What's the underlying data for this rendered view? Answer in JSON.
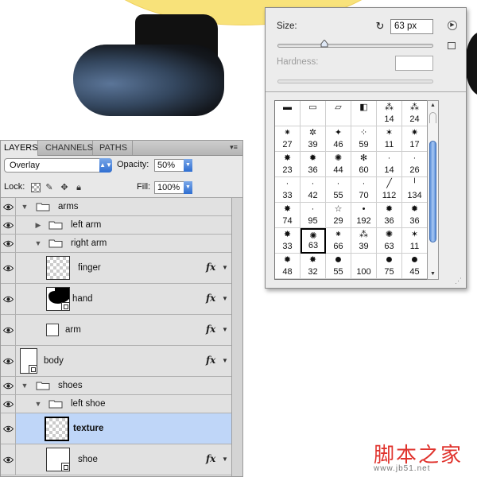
{
  "layers_panel": {
    "tabs": [
      "LAYERS",
      "CHANNELS",
      "PATHS"
    ],
    "blend_mode": "Overlay",
    "opacity_label": "Opacity:",
    "opacity_value": "50%",
    "lock_label": "Lock:",
    "fill_label": "Fill:",
    "fill_value": "100%",
    "layers": [
      {
        "name": "arms",
        "kind": "group",
        "expanded": true,
        "depth": 0
      },
      {
        "name": "left arm",
        "kind": "group",
        "expanded": false,
        "depth": 1
      },
      {
        "name": "right arm",
        "kind": "group",
        "expanded": true,
        "depth": 1
      },
      {
        "name": "finger",
        "kind": "layer",
        "depth": 2,
        "fx": "fx"
      },
      {
        "name": "hand",
        "kind": "layer",
        "depth": 2,
        "fx": "fx"
      },
      {
        "name": "arm",
        "kind": "layer",
        "depth": 1,
        "fx": "fx"
      },
      {
        "name": "body",
        "kind": "layer",
        "depth": 0,
        "fx": "fx"
      },
      {
        "name": "shoes",
        "kind": "group",
        "expanded": true,
        "depth": 0
      },
      {
        "name": "left shoe",
        "kind": "group",
        "expanded": true,
        "depth": 1
      },
      {
        "name": "texture",
        "kind": "layer",
        "depth": 2,
        "selected": true
      },
      {
        "name": "shoe",
        "kind": "layer",
        "depth": 2,
        "fx": "fx"
      }
    ]
  },
  "brush_panel": {
    "size_label": "Size:",
    "size_value": "63 px",
    "size_slider": 0.3,
    "hardness_label": "Hardness:",
    "presets": [
      {
        "label": "",
        "glyph": "▬"
      },
      {
        "label": "",
        "glyph": "▭"
      },
      {
        "label": "",
        "glyph": "▱"
      },
      {
        "label": "",
        "glyph": "◧"
      },
      {
        "label": "14",
        "glyph": "⁂"
      },
      {
        "label": "24",
        "glyph": "⁂"
      },
      {
        "label": "27",
        "glyph": "⁕"
      },
      {
        "label": "39",
        "glyph": "✲"
      },
      {
        "label": "46",
        "glyph": "✦"
      },
      {
        "label": "59",
        "glyph": "⁘"
      },
      {
        "label": "11",
        "glyph": "✶"
      },
      {
        "label": "17",
        "glyph": "✷"
      },
      {
        "label": "23",
        "glyph": "✸"
      },
      {
        "label": "36",
        "glyph": "✹"
      },
      {
        "label": "44",
        "glyph": "✺"
      },
      {
        "label": "60",
        "glyph": "✻"
      },
      {
        "label": "14",
        "glyph": "·"
      },
      {
        "label": "26",
        "glyph": "·"
      },
      {
        "label": "33",
        "glyph": "·"
      },
      {
        "label": "42",
        "glyph": "·"
      },
      {
        "label": "55",
        "glyph": "·"
      },
      {
        "label": "70",
        "glyph": "·"
      },
      {
        "label": "112",
        "glyph": "╱"
      },
      {
        "label": "134",
        "glyph": "╵"
      },
      {
        "label": "74",
        "glyph": "✸"
      },
      {
        "label": "95",
        "glyph": "·"
      },
      {
        "label": "29",
        "glyph": "☆"
      },
      {
        "label": "192",
        "glyph": "•"
      },
      {
        "label": "36",
        "glyph": "✹"
      },
      {
        "label": "36",
        "glyph": "✹"
      },
      {
        "label": "33",
        "glyph": "✸"
      },
      {
        "label": "63",
        "glyph": "✺",
        "selected": true
      },
      {
        "label": "66",
        "glyph": "⁕"
      },
      {
        "label": "39",
        "glyph": "⁂"
      },
      {
        "label": "63",
        "glyph": "✺"
      },
      {
        "label": "11",
        "glyph": "✶"
      },
      {
        "label": "48",
        "glyph": "✹"
      },
      {
        "label": "32",
        "glyph": "✸"
      },
      {
        "label": "55",
        "glyph": "●"
      },
      {
        "label": "100",
        "glyph": ""
      },
      {
        "label": "75",
        "glyph": "●"
      },
      {
        "label": "45",
        "glyph": "●"
      }
    ]
  },
  "watermark": {
    "cn": "脚本之家",
    "url": "www.jb51.net"
  }
}
